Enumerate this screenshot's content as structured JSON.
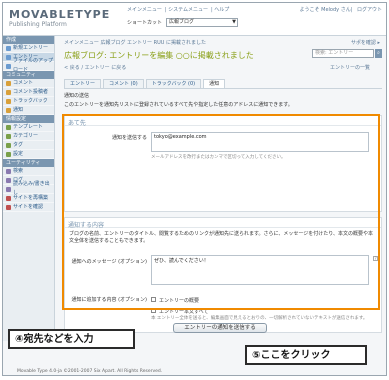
{
  "header": {
    "logo_main": "MOVABLETYPE",
    "logo_sub": "Publishing Platform",
    "top_links": [
      "メインメニュー",
      "システムメニュー",
      "ヘルプ"
    ],
    "user_links": [
      "ようこそ Melody さん",
      "ログアウト"
    ],
    "blog_select_label": "ショートカット",
    "blog_select_value": "広報ブログ"
  },
  "sidebar": {
    "sections": [
      {
        "title": "作成",
        "items": [
          {
            "label": "新規エントリー",
            "icon": "pencil-icon",
            "color": "#6a9bd0"
          },
          {
            "label": "エントリー",
            "icon": "document-icon",
            "color": "#6a9bd0"
          },
          {
            "label": "ファイルのアップロード",
            "icon": "upload-icon",
            "color": "#6a9bd0"
          }
        ]
      },
      {
        "title": "コミュニティ",
        "items": [
          {
            "label": "コメント",
            "icon": "comment-icon",
            "color": "#d9a03a"
          },
          {
            "label": "コメント投稿者",
            "icon": "commenter-icon",
            "color": "#d9a03a"
          },
          {
            "label": "トラックバック",
            "icon": "trackback-icon",
            "color": "#d9a03a"
          },
          {
            "label": "通知",
            "icon": "notify-icon",
            "color": "#d9a03a"
          }
        ]
      },
      {
        "title": "情報設定",
        "items": [
          {
            "label": "テンプレート",
            "icon": "template-icon",
            "color": "#7aa04a"
          },
          {
            "label": "カテゴリー",
            "icon": "category-icon",
            "color": "#7aa04a"
          },
          {
            "label": "タグ",
            "icon": "tag-icon",
            "color": "#7aa04a"
          },
          {
            "label": "設定",
            "icon": "settings-icon",
            "color": "#7aa04a"
          }
        ]
      },
      {
        "title": "ユーティリティ",
        "items": [
          {
            "label": "検索",
            "icon": "search-icon",
            "color": "#8a7ab0"
          },
          {
            "label": "ログ",
            "icon": "log-icon",
            "color": "#8a7ab0"
          },
          {
            "label": "読み込み/書き出し",
            "icon": "import-export-icon",
            "color": "#8a7ab0"
          },
          {
            "label": "サイトを再構築",
            "icon": "rebuild-icon",
            "color": "#c05050"
          },
          {
            "label": "サイトを確認",
            "icon": "view-site-icon",
            "color": "#c05050"
          }
        ]
      }
    ]
  },
  "main": {
    "breadcrumb": "メインメニュー 広報ブログ エントリー RUU に掲載されました",
    "help_link": "サポを確認 ▸",
    "title": "広報ブログ: エントリーを編集 ○○に掲載されました",
    "search_placeholder": "検索: エントリー",
    "back_link": "< 戻る / エントリー に戻る",
    "list_link": "エントリーの一覧",
    "tabs": [
      "エントリー",
      "コメント (0)",
      "トラックバック (0)",
      "通知"
    ],
    "section_label": "通知の送信",
    "section_desc": "このエントリーを通知先リストに登録されているすべて先や指定した任意のアドレスに通知できます。",
    "recipient": {
      "heading": "あて先",
      "label": "通知を送信する",
      "value": "tokyo@example.com",
      "hint": "メールアドレスを改行またはカンマで区切って入力してください。"
    },
    "content": {
      "heading": "通知する内容",
      "description": "ブログの名前、エントリーのタイトル、閲覧するためのリンクが通知先に送られます。さらに、メッセージを付けたり、本文の概要や本文全体を送信することもできます。",
      "message_label": "通知へのメッセージ (オプション)",
      "message_value": "ぜひ、読んでください！",
      "options_label": "通知に追加する内容 (オプション)",
      "option1": "エントリーの概要",
      "option2": "エントリー本文すべて",
      "option2_hint": "本 エントリー全体を送ると、編集画面で見えるとおりの、一切解析されていないテキストが送信されます。"
    },
    "submit_label": "エントリーの通知を送信する"
  },
  "callouts": {
    "step4": "④宛先などを入力",
    "step5": "⑤ここをクリック"
  },
  "footer": "Movable Type 4.0-ja  ©2001-2007 Six Apart. All Rights Reserved.",
  "colors": {
    "highlight": "#f08a00",
    "title_green": "#8aa018",
    "sidebar_header": "#7a96b0",
    "link_blue": "#2b5b8a"
  }
}
